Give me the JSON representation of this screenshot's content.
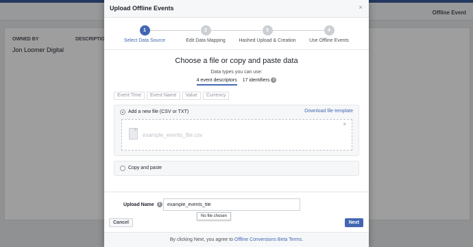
{
  "background": {
    "header_right": "Offline Event",
    "owned_by_label": "OWNED BY",
    "description_label": "DESCRIPTION",
    "owner_name": "Jon Loomer Digital"
  },
  "modal": {
    "title": "Upload Offline Events",
    "close_glyph": "×",
    "steps": [
      {
        "number": "1",
        "label": "Select Data Source",
        "active": true
      },
      {
        "number": "2",
        "label": "Edit Data Mapping",
        "active": false
      },
      {
        "number": "3",
        "label": "Hashed Upload & Creation",
        "active": false
      },
      {
        "number": "4",
        "label": "Use Offline Events",
        "active": false
      }
    ],
    "choose_title": "Choose a file or copy and paste data",
    "data_types_label": "Data types you can use:",
    "event_descriptors_tab": "4 event descriptors",
    "identifiers_tab": "17 identifiers",
    "info_glyph": "i",
    "chips": [
      "Event Time",
      "Event Name",
      "Value",
      "Currency"
    ],
    "upload_option_label": "Add a new file (CSV or TXT)",
    "download_template_link": "Download file template",
    "file_name": "example_events_file.csv",
    "remove_glyph": "×",
    "paste_option_label": "Copy and paste",
    "upload_name_label": "Upload Name",
    "upload_name_value": "example_events_file",
    "tooltip_text": "No file chosen",
    "cancel_label": "Cancel",
    "next_label": "Next",
    "footer_prefix": "By clicking Next, you agree to",
    "footer_link": "Offline Conversions Beta Terms",
    "footer_suffix": "."
  },
  "colors": {
    "accent": "#4267b2",
    "overlay": "rgba(0,0,0,0.38)"
  }
}
